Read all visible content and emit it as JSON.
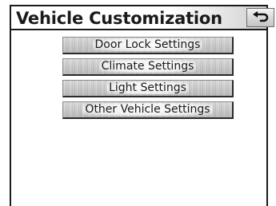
{
  "header": {
    "title": "Vehicle Customization",
    "back_icon": "return-arrow-icon"
  },
  "menu": {
    "items": [
      {
        "label": "Door Lock Settings"
      },
      {
        "label": "Climate Settings"
      },
      {
        "label": "Light Settings"
      },
      {
        "label": "Other Vehicle Settings"
      }
    ]
  }
}
